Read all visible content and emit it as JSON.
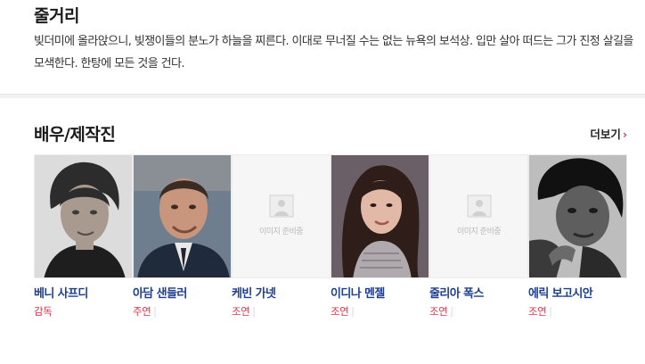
{
  "synopsis": {
    "title": "줄거리",
    "text": "빚더미에 올라앉으니, 빚쟁이들의 분노가 하늘을 찌른다. 이대로 무너질 수는 없는 뉴욕의 보석상. 입만 살아 떠드는 그가 진정 살길을 모색한다. 한탕에 모든 것을 건다."
  },
  "cast": {
    "title": "배우/제작진",
    "more_label": "더보기",
    "more_icon": "chevron-right-icon",
    "placeholder_label": "이미지 준비중",
    "members": [
      {
        "name": "베니 사프디",
        "role": "감독"
      },
      {
        "name": "아담 샌들러",
        "role": "주연"
      },
      {
        "name": "케빈 가넷",
        "role": "조연"
      },
      {
        "name": "이디나 멘젤",
        "role": "조연"
      },
      {
        "name": "줄리아 폭스",
        "role": "조연"
      },
      {
        "name": "에릭 보고시안",
        "role": "조연"
      }
    ]
  },
  "colors": {
    "accent_red": "#d9344a",
    "name_blue": "#1c3f8f"
  }
}
